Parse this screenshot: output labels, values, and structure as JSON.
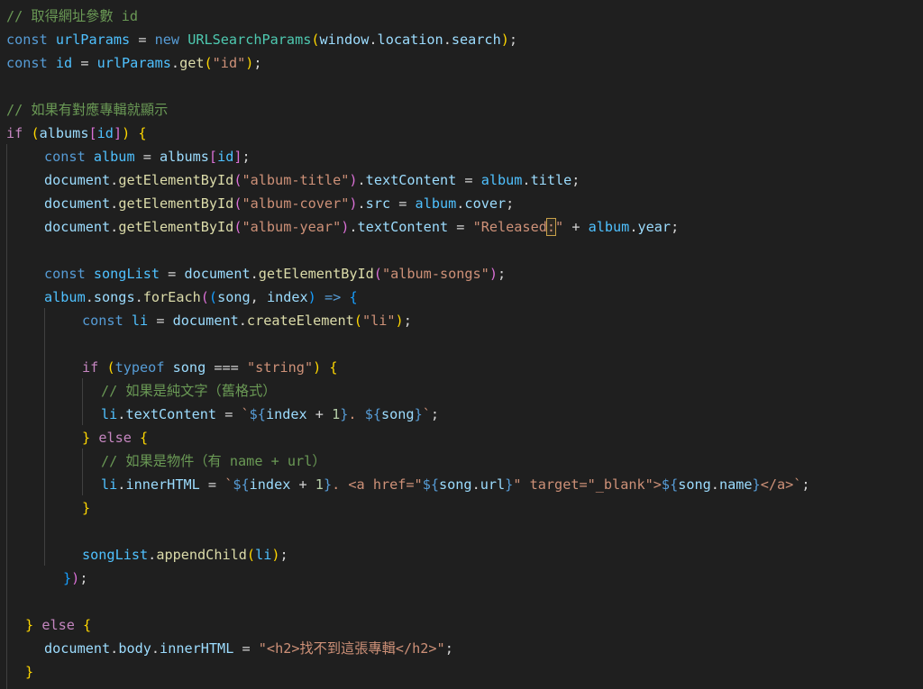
{
  "colors": {
    "background": "#1f1f1f",
    "comment": "#6a9955",
    "keyword_blue": "#569cd6",
    "control_purple": "#c586c0",
    "variable": "#9cdcfe",
    "constant": "#4fc1ff",
    "function": "#dcdcaa",
    "class": "#4ec9b0",
    "string": "#ce9178",
    "number": "#b5cea8",
    "plain": "#d4d4d4",
    "bracket_gold": "#ffd700",
    "bracket_pink": "#da70d6",
    "bracket_blue": "#179fff"
  },
  "lines": [
    {
      "indent": 0,
      "tokens": [
        {
          "t": "// 取得網址參數 id",
          "c": "comment"
        }
      ]
    },
    {
      "indent": 0,
      "tokens": [
        {
          "t": "const",
          "c": "keyword_blue"
        },
        {
          "t": " ",
          "c": "plain"
        },
        {
          "t": "urlParams",
          "c": "constant"
        },
        {
          "t": " = ",
          "c": "plain"
        },
        {
          "t": "new",
          "c": "keyword_blue"
        },
        {
          "t": " ",
          "c": "plain"
        },
        {
          "t": "URLSearchParams",
          "c": "class"
        },
        {
          "t": "(",
          "c": "bracket_gold"
        },
        {
          "t": "window",
          "c": "variable"
        },
        {
          "t": ".",
          "c": "plain"
        },
        {
          "t": "location",
          "c": "variable"
        },
        {
          "t": ".",
          "c": "plain"
        },
        {
          "t": "search",
          "c": "variable"
        },
        {
          "t": ")",
          "c": "bracket_gold"
        },
        {
          "t": ";",
          "c": "plain"
        }
      ]
    },
    {
      "indent": 0,
      "tokens": [
        {
          "t": "const",
          "c": "keyword_blue"
        },
        {
          "t": " ",
          "c": "plain"
        },
        {
          "t": "id",
          "c": "constant"
        },
        {
          "t": " = ",
          "c": "plain"
        },
        {
          "t": "urlParams",
          "c": "constant"
        },
        {
          "t": ".",
          "c": "plain"
        },
        {
          "t": "get",
          "c": "function"
        },
        {
          "t": "(",
          "c": "bracket_gold"
        },
        {
          "t": "\"id\"",
          "c": "string"
        },
        {
          "t": ")",
          "c": "bracket_gold"
        },
        {
          "t": ";",
          "c": "plain"
        }
      ]
    },
    {
      "indent": 0,
      "tokens": []
    },
    {
      "indent": 0,
      "tokens": [
        {
          "t": "// 如果有對應專輯就顯示",
          "c": "comment"
        }
      ]
    },
    {
      "indent": 0,
      "tokens": [
        {
          "t": "if",
          "c": "control_purple"
        },
        {
          "t": " ",
          "c": "plain"
        },
        {
          "t": "(",
          "c": "bracket_gold"
        },
        {
          "t": "albums",
          "c": "variable"
        },
        {
          "t": "[",
          "c": "bracket_pink"
        },
        {
          "t": "id",
          "c": "constant"
        },
        {
          "t": "]",
          "c": "bracket_pink"
        },
        {
          "t": ")",
          "c": "bracket_gold"
        },
        {
          "t": " ",
          "c": "plain"
        },
        {
          "t": "{",
          "c": "bracket_gold"
        }
      ]
    },
    {
      "indent": 1,
      "tokens": [
        {
          "t": "const",
          "c": "keyword_blue"
        },
        {
          "t": " ",
          "c": "plain"
        },
        {
          "t": "album",
          "c": "constant"
        },
        {
          "t": " = ",
          "c": "plain"
        },
        {
          "t": "albums",
          "c": "variable"
        },
        {
          "t": "[",
          "c": "bracket_pink"
        },
        {
          "t": "id",
          "c": "constant"
        },
        {
          "t": "]",
          "c": "bracket_pink"
        },
        {
          "t": ";",
          "c": "plain"
        }
      ]
    },
    {
      "indent": 1,
      "tokens": [
        {
          "t": "document",
          "c": "variable"
        },
        {
          "t": ".",
          "c": "plain"
        },
        {
          "t": "getElementById",
          "c": "function"
        },
        {
          "t": "(",
          "c": "bracket_pink"
        },
        {
          "t": "\"album-title\"",
          "c": "string"
        },
        {
          "t": ")",
          "c": "bracket_pink"
        },
        {
          "t": ".",
          "c": "plain"
        },
        {
          "t": "textContent",
          "c": "variable"
        },
        {
          "t": " = ",
          "c": "plain"
        },
        {
          "t": "album",
          "c": "constant"
        },
        {
          "t": ".",
          "c": "plain"
        },
        {
          "t": "title",
          "c": "variable"
        },
        {
          "t": ";",
          "c": "plain"
        }
      ]
    },
    {
      "indent": 1,
      "tokens": [
        {
          "t": "document",
          "c": "variable"
        },
        {
          "t": ".",
          "c": "plain"
        },
        {
          "t": "getElementById",
          "c": "function"
        },
        {
          "t": "(",
          "c": "bracket_pink"
        },
        {
          "t": "\"album-cover\"",
          "c": "string"
        },
        {
          "t": ")",
          "c": "bracket_pink"
        },
        {
          "t": ".",
          "c": "plain"
        },
        {
          "t": "src",
          "c": "variable"
        },
        {
          "t": " = ",
          "c": "plain"
        },
        {
          "t": "album",
          "c": "constant"
        },
        {
          "t": ".",
          "c": "plain"
        },
        {
          "t": "cover",
          "c": "variable"
        },
        {
          "t": ";",
          "c": "plain"
        }
      ]
    },
    {
      "indent": 1,
      "tokens": [
        {
          "t": "document",
          "c": "variable"
        },
        {
          "t": ".",
          "c": "plain"
        },
        {
          "t": "getElementById",
          "c": "function"
        },
        {
          "t": "(",
          "c": "bracket_pink"
        },
        {
          "t": "\"album-year\"",
          "c": "string"
        },
        {
          "t": ")",
          "c": "bracket_pink"
        },
        {
          "t": ".",
          "c": "plain"
        },
        {
          "t": "textContent",
          "c": "variable"
        },
        {
          "t": " = ",
          "c": "plain"
        },
        {
          "t": "\"Released",
          "c": "string"
        },
        {
          "t": ":",
          "c": "string",
          "hl": true
        },
        {
          "t": "\"",
          "c": "string"
        },
        {
          "t": " + ",
          "c": "plain"
        },
        {
          "t": "album",
          "c": "constant"
        },
        {
          "t": ".",
          "c": "plain"
        },
        {
          "t": "year",
          "c": "variable"
        },
        {
          "t": ";",
          "c": "plain"
        }
      ]
    },
    {
      "indent": 1,
      "tokens": []
    },
    {
      "indent": 1,
      "tokens": [
        {
          "t": "const",
          "c": "keyword_blue"
        },
        {
          "t": " ",
          "c": "plain"
        },
        {
          "t": "songList",
          "c": "constant"
        },
        {
          "t": " = ",
          "c": "plain"
        },
        {
          "t": "document",
          "c": "variable"
        },
        {
          "t": ".",
          "c": "plain"
        },
        {
          "t": "getElementById",
          "c": "function"
        },
        {
          "t": "(",
          "c": "bracket_pink"
        },
        {
          "t": "\"album-songs\"",
          "c": "string"
        },
        {
          "t": ")",
          "c": "bracket_pink"
        },
        {
          "t": ";",
          "c": "plain"
        }
      ]
    },
    {
      "indent": 1,
      "tokens": [
        {
          "t": "album",
          "c": "constant"
        },
        {
          "t": ".",
          "c": "plain"
        },
        {
          "t": "songs",
          "c": "variable"
        },
        {
          "t": ".",
          "c": "plain"
        },
        {
          "t": "forEach",
          "c": "function"
        },
        {
          "t": "(",
          "c": "bracket_pink"
        },
        {
          "t": "(",
          "c": "bracket_blue"
        },
        {
          "t": "song",
          "c": "variable"
        },
        {
          "t": ", ",
          "c": "plain"
        },
        {
          "t": "index",
          "c": "variable"
        },
        {
          "t": ")",
          "c": "bracket_blue"
        },
        {
          "t": " ",
          "c": "plain"
        },
        {
          "t": "=>",
          "c": "keyword_blue"
        },
        {
          "t": " ",
          "c": "plain"
        },
        {
          "t": "{",
          "c": "bracket_blue"
        }
      ]
    },
    {
      "indent": 2,
      "tokens": [
        {
          "t": "const",
          "c": "keyword_blue"
        },
        {
          "t": " ",
          "c": "plain"
        },
        {
          "t": "li",
          "c": "constant"
        },
        {
          "t": " = ",
          "c": "plain"
        },
        {
          "t": "document",
          "c": "variable"
        },
        {
          "t": ".",
          "c": "plain"
        },
        {
          "t": "createElement",
          "c": "function"
        },
        {
          "t": "(",
          "c": "bracket_gold"
        },
        {
          "t": "\"li\"",
          "c": "string"
        },
        {
          "t": ")",
          "c": "bracket_gold"
        },
        {
          "t": ";",
          "c": "plain"
        }
      ]
    },
    {
      "indent": 2,
      "tokens": []
    },
    {
      "indent": 2,
      "tokens": [
        {
          "t": "if",
          "c": "control_purple"
        },
        {
          "t": " ",
          "c": "plain"
        },
        {
          "t": "(",
          "c": "bracket_gold"
        },
        {
          "t": "typeof",
          "c": "keyword_blue"
        },
        {
          "t": " ",
          "c": "plain"
        },
        {
          "t": "song",
          "c": "variable"
        },
        {
          "t": " === ",
          "c": "plain"
        },
        {
          "t": "\"string\"",
          "c": "string"
        },
        {
          "t": ")",
          "c": "bracket_gold"
        },
        {
          "t": " ",
          "c": "plain"
        },
        {
          "t": "{",
          "c": "bracket_gold"
        }
      ]
    },
    {
      "indent": 2.5,
      "tokens": [
        {
          "t": "// 如果是純文字（舊格式）",
          "c": "comment"
        }
      ]
    },
    {
      "indent": 2.5,
      "tokens": [
        {
          "t": "li",
          "c": "constant"
        },
        {
          "t": ".",
          "c": "plain"
        },
        {
          "t": "textContent",
          "c": "variable"
        },
        {
          "t": " = ",
          "c": "plain"
        },
        {
          "t": "`",
          "c": "string"
        },
        {
          "t": "${",
          "c": "keyword_blue"
        },
        {
          "t": "index",
          "c": "variable"
        },
        {
          "t": " + ",
          "c": "plain"
        },
        {
          "t": "1",
          "c": "number"
        },
        {
          "t": "}",
          "c": "keyword_blue"
        },
        {
          "t": ". ",
          "c": "string"
        },
        {
          "t": "${",
          "c": "keyword_blue"
        },
        {
          "t": "song",
          "c": "variable"
        },
        {
          "t": "}",
          "c": "keyword_blue"
        },
        {
          "t": "`",
          "c": "string"
        },
        {
          "t": ";",
          "c": "plain"
        }
      ]
    },
    {
      "indent": 2,
      "tokens": [
        {
          "t": "}",
          "c": "bracket_gold"
        },
        {
          "t": " ",
          "c": "plain"
        },
        {
          "t": "else",
          "c": "control_purple"
        },
        {
          "t": " ",
          "c": "plain"
        },
        {
          "t": "{",
          "c": "bracket_gold"
        }
      ]
    },
    {
      "indent": 2.5,
      "tokens": [
        {
          "t": "// 如果是物件（有 name + url）",
          "c": "comment"
        }
      ]
    },
    {
      "indent": 2.5,
      "tokens": [
        {
          "t": "li",
          "c": "constant"
        },
        {
          "t": ".",
          "c": "plain"
        },
        {
          "t": "innerHTML",
          "c": "variable"
        },
        {
          "t": " = ",
          "c": "plain"
        },
        {
          "t": "`",
          "c": "string"
        },
        {
          "t": "${",
          "c": "keyword_blue"
        },
        {
          "t": "index",
          "c": "variable"
        },
        {
          "t": " + ",
          "c": "plain"
        },
        {
          "t": "1",
          "c": "number"
        },
        {
          "t": "}",
          "c": "keyword_blue"
        },
        {
          "t": ". <a href=\"",
          "c": "string"
        },
        {
          "t": "${",
          "c": "keyword_blue"
        },
        {
          "t": "song",
          "c": "variable"
        },
        {
          "t": ".",
          "c": "plain"
        },
        {
          "t": "url",
          "c": "variable"
        },
        {
          "t": "}",
          "c": "keyword_blue"
        },
        {
          "t": "\" target=\"_blank\">",
          "c": "string"
        },
        {
          "t": "${",
          "c": "keyword_blue"
        },
        {
          "t": "song",
          "c": "variable"
        },
        {
          "t": ".",
          "c": "plain"
        },
        {
          "t": "name",
          "c": "variable"
        },
        {
          "t": "}",
          "c": "keyword_blue"
        },
        {
          "t": "</a>`",
          "c": "string"
        },
        {
          "t": ";",
          "c": "plain"
        }
      ]
    },
    {
      "indent": 2,
      "tokens": [
        {
          "t": "}",
          "c": "bracket_gold"
        }
      ]
    },
    {
      "indent": 2,
      "tokens": []
    },
    {
      "indent": 2,
      "tokens": [
        {
          "t": "songList",
          "c": "constant"
        },
        {
          "t": ".",
          "c": "plain"
        },
        {
          "t": "appendChild",
          "c": "function"
        },
        {
          "t": "(",
          "c": "bracket_gold"
        },
        {
          "t": "li",
          "c": "constant"
        },
        {
          "t": ")",
          "c": "bracket_gold"
        },
        {
          "t": ";",
          "c": "plain"
        }
      ]
    },
    {
      "indent": 1.5,
      "tokens": [
        {
          "t": "}",
          "c": "bracket_blue"
        },
        {
          "t": ")",
          "c": "bracket_pink"
        },
        {
          "t": ";",
          "c": "plain"
        }
      ]
    },
    {
      "indent": 0,
      "tokens": []
    },
    {
      "indent": 0.5,
      "tokens": [
        {
          "t": "}",
          "c": "bracket_gold"
        },
        {
          "t": " ",
          "c": "plain"
        },
        {
          "t": "else",
          "c": "control_purple"
        },
        {
          "t": " ",
          "c": "plain"
        },
        {
          "t": "{",
          "c": "bracket_gold"
        }
      ]
    },
    {
      "indent": 1,
      "tokens": [
        {
          "t": "document",
          "c": "variable"
        },
        {
          "t": ".",
          "c": "plain"
        },
        {
          "t": "body",
          "c": "variable"
        },
        {
          "t": ".",
          "c": "plain"
        },
        {
          "t": "innerHTML",
          "c": "variable"
        },
        {
          "t": " = ",
          "c": "plain"
        },
        {
          "t": "\"<h2>找不到這張專輯</h2>\"",
          "c": "string"
        },
        {
          "t": ";",
          "c": "plain"
        }
      ]
    },
    {
      "indent": 0.5,
      "tokens": [
        {
          "t": "}",
          "c": "bracket_gold"
        }
      ]
    }
  ]
}
